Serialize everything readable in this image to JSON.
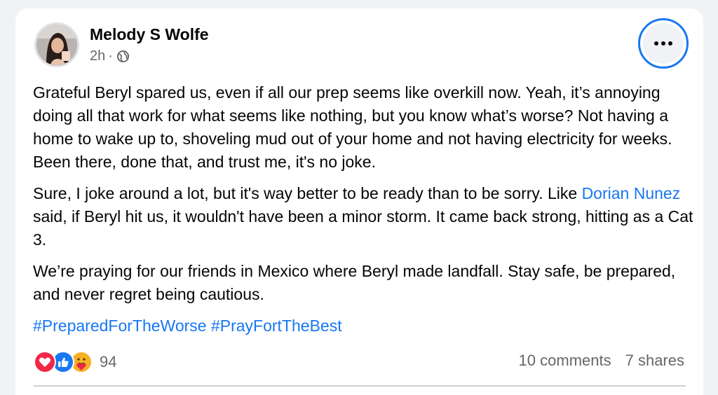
{
  "post": {
    "author": "Melody S Wolfe",
    "time": "2h",
    "separator": "·",
    "privacy_icon": "globe-icon",
    "more_icon": "more-horizontal-icon",
    "paragraph1": "Grateful Beryl spared us, even if all our prep seems like overkill now. Yeah, it’s annoying doing all that work for what seems like nothing, but you know what’s worse? Not having a home to wake up to, shoveling mud out of your home and not having electricity for weeks. Been there, done that, and trust me, it's no joke.",
    "paragraph2_before": "Sure, I joke around a lot, but it's way better to be ready than to be sorry. Like ",
    "mention": "Dorian Nunez",
    "paragraph2_after": "  said, if Beryl hit us, it wouldn't have been a minor storm. It came back strong, hitting as a Cat 3.",
    "paragraph3": "We’re praying for our friends in Mexico where Beryl made landfall. Stay safe, be prepared, and never regret being cautious.",
    "hashtag1": "#PreparedForTheWorse",
    "hashtag2": "#PrayFortTheBest"
  },
  "reactions": {
    "icons": [
      "love-reaction-icon",
      "like-reaction-icon",
      "care-reaction-icon"
    ],
    "count": "94"
  },
  "stats": {
    "comments": "10 comments",
    "shares": "7 shares"
  },
  "colors": {
    "link": "#1877f2",
    "secondary_text": "#65676b",
    "love": "#f02849",
    "like": "#1877f2",
    "care": "#f7b125",
    "focus_ring": "#1877f2"
  }
}
